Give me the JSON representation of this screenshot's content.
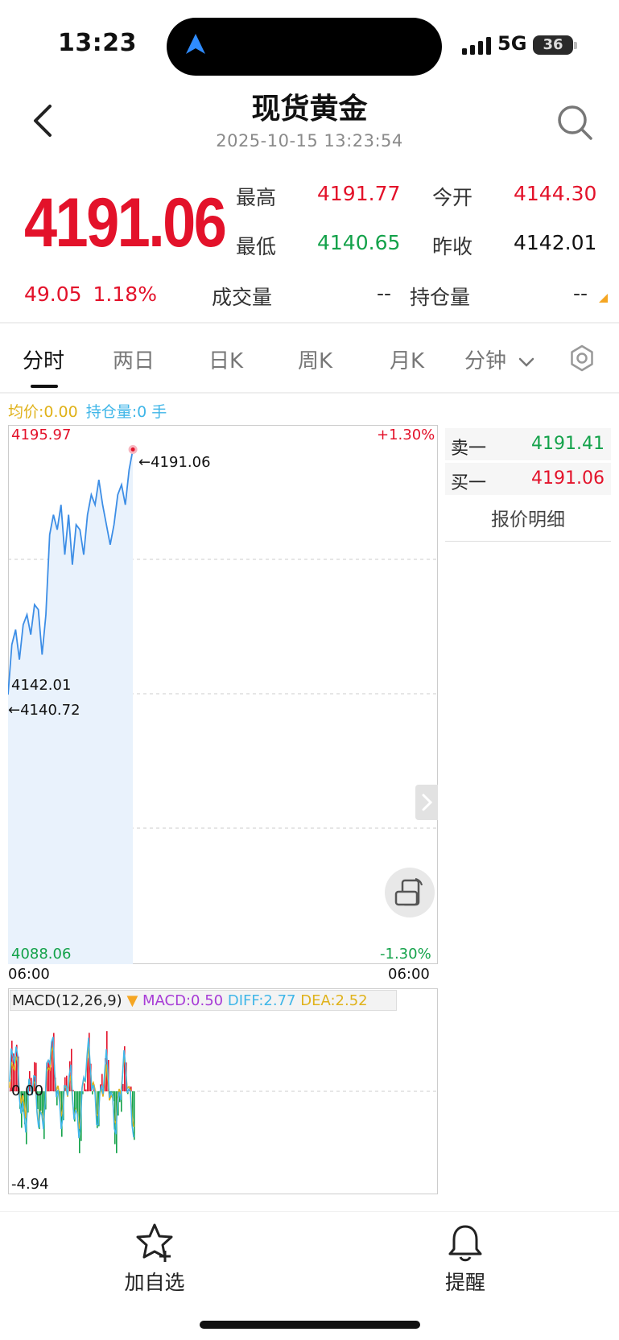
{
  "status_bar": {
    "time": "13:23",
    "network": "5G",
    "battery": "36"
  },
  "header": {
    "title": "现货黄金",
    "datetime": "2025-10-15 13:23:54"
  },
  "quote": {
    "price": "4191.06",
    "change": "49.05",
    "change_pct": "1.18%",
    "stats": [
      {
        "label": "最高",
        "value": "4191.77"
      },
      {
        "label": "今开",
        "value": "4144.30"
      },
      {
        "label": "最低",
        "value": "4140.65"
      },
      {
        "label": "昨收",
        "value": "4142.01"
      }
    ],
    "volume_label": "成交量",
    "volume_value": "--",
    "open_interest_label": "持仓量",
    "open_interest_value": "--",
    "colors": {
      "up": "#e3122a",
      "down": "#13a24a"
    }
  },
  "tabs": [
    {
      "label": "分时",
      "active": true
    },
    {
      "label": "两日"
    },
    {
      "label": "日K"
    },
    {
      "label": "周K"
    },
    {
      "label": "月K"
    },
    {
      "label": "分钟"
    }
  ],
  "settings_icon": "gear-icon",
  "chart": {
    "avg_label": "均价:0.00",
    "oi_label": "持仓量:0 手",
    "y_max": "4195.97",
    "y_min": "4088.06",
    "pct_max": "+1.30%",
    "pct_min": "-1.30%",
    "ref_price": "4142.01",
    "last_price_tag": "←4191.06",
    "low_price_tag": "←4140.72",
    "time_start": "06:00",
    "time_end": "06:00"
  },
  "orderbook": {
    "ask_label": "卖一",
    "ask_value": "4191.41",
    "bid_label": "买一",
    "bid_value": "4191.06",
    "detail_label": "报价明细"
  },
  "macd": {
    "title": "MACD(12,26,9)",
    "macd": "MACD:0.50",
    "diff": "DIFF:2.77",
    "dea": "DEA:2.52",
    "zero": "0.00",
    "min": "-4.94",
    "colors": {
      "macd": "#a73bd6",
      "diff": "#3fb6e8",
      "dea": "#e0b21a"
    }
  },
  "chart_data": {
    "type": "line",
    "x": [
      0,
      2,
      4,
      6,
      8,
      10,
      12,
      14,
      16,
      18,
      20,
      22,
      24,
      26,
      28,
      30,
      32,
      34,
      36,
      38,
      40,
      42,
      44,
      46,
      48,
      50,
      52,
      54,
      56,
      58,
      60,
      62,
      64,
      66
    ],
    "values": [
      4142,
      4152,
      4155,
      4149,
      4156,
      4158,
      4154,
      4160,
      4159,
      4150,
      4158,
      4174,
      4178,
      4175,
      4180,
      4170,
      4178,
      4168,
      4176,
      4175,
      4170,
      4178,
      4182,
      4180,
      4185,
      4180,
      4176,
      4172,
      4176,
      4182,
      4184,
      4180,
      4187,
      4191.06
    ],
    "ylim": [
      4088.06,
      4195.97
    ]
  }
}
